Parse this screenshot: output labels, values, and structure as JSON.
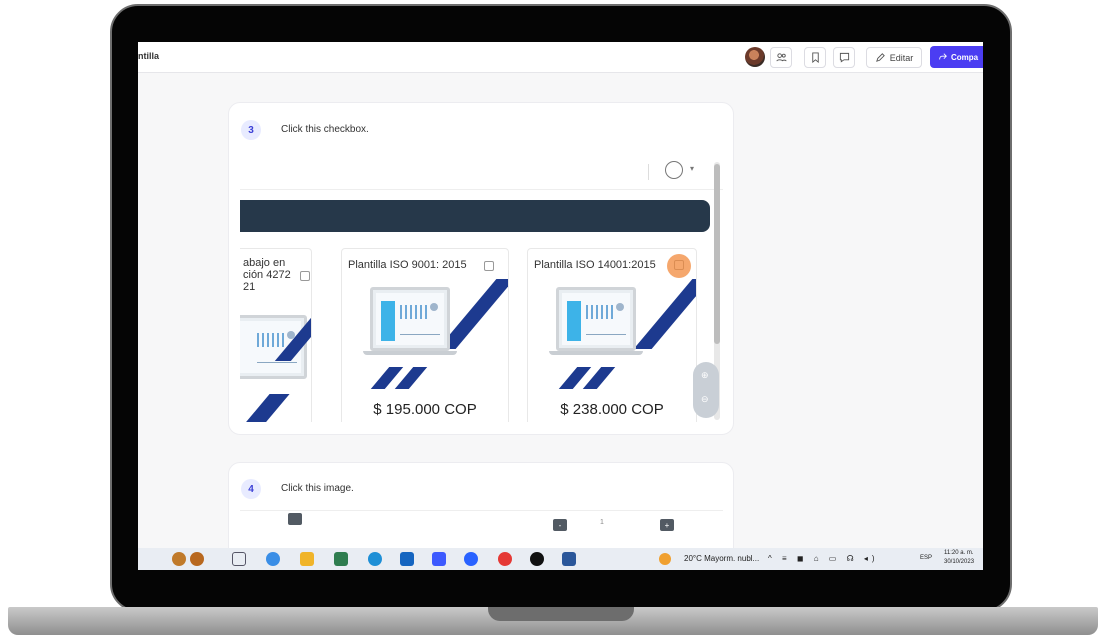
{
  "app": {
    "title": "ntilla"
  },
  "toolbar": {
    "edit_label": "Editar",
    "share_label": "Compa"
  },
  "step3": {
    "number": "3",
    "instruction": "Click this checkbox.",
    "products": [
      {
        "title_line1": "abajo en",
        "title_line2": "ción 4272",
        "title_line3": "21"
      },
      {
        "title": "Plantilla ISO 9001: 2015",
        "price": "$ 195.000 COP"
      },
      {
        "title": "Plantilla ISO 14001:2015",
        "price": "$ 238.000 COP"
      }
    ]
  },
  "step4": {
    "number": "4",
    "instruction": "Click this image.",
    "quantity": "1"
  },
  "taskbar": {
    "weather": "20°C Mayorm. nubl...",
    "language": "ESP",
    "time": "11:20 a. m.",
    "date": "30/10/2023"
  },
  "colors": {
    "accent": "#4b3df2",
    "navy": "#26384a",
    "stripe_blue": "#1d3a8f",
    "highlight": "#f28a3c"
  }
}
